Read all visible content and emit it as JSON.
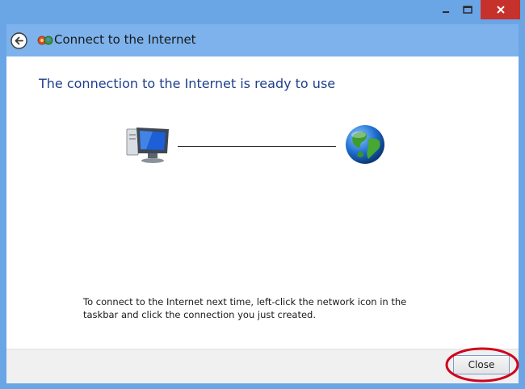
{
  "window": {
    "title": "Connect to the Internet",
    "caption_buttons": {
      "minimize": "minimize",
      "maximize": "maximize",
      "close": "close"
    }
  },
  "main": {
    "headline": "The connection to the Internet is ready to use",
    "info_text": "To connect to the Internet next time, left-click the network icon in the taskbar and click the connection you just created."
  },
  "footer": {
    "close_label": "Close"
  },
  "icons": {
    "back": "back-arrow-icon",
    "network": "network-connection-icon",
    "computer": "computer-icon",
    "globe": "globe-icon"
  },
  "colors": {
    "frame": "#6aa5e6",
    "header": "#7db2ec",
    "headline": "#1e3f8c",
    "caption_close": "#c7312b",
    "annotation": "#d0021b"
  }
}
